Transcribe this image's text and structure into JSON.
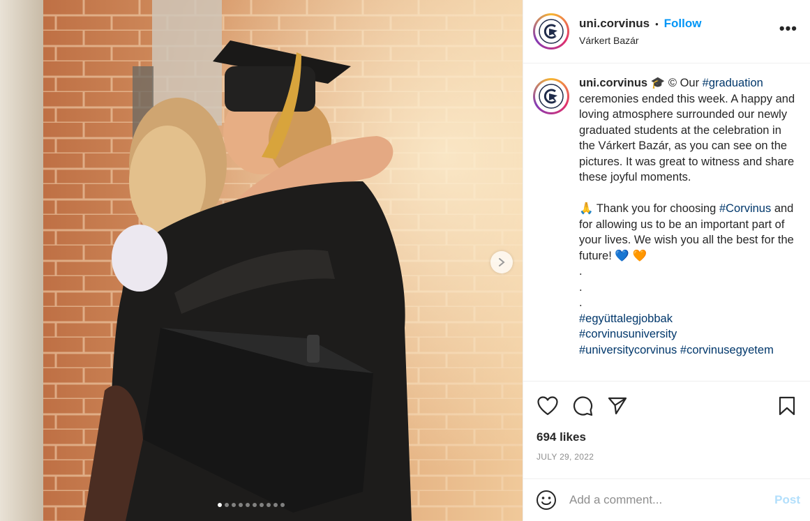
{
  "post": {
    "photo": {
      "alt_subject": "graduate-hug-photo",
      "carousel": {
        "total": 10,
        "active_index": 0
      }
    },
    "header": {
      "username": "uni.corvinus",
      "separator": "•",
      "follow_label": "Follow",
      "location": "Várkert Bazár",
      "more_label": "•••"
    },
    "caption": {
      "username": "uni.corvinus",
      "emoji_cap": "🎓",
      "p1_before": " © Our ",
      "tag_graduation": "#graduation",
      "p1_after": " ceremonies ended this week. A happy and loving atmosphere surrounded our newly graduated students at the celebration in the Várkert Bazár, as you can see on the pictures. It was great to witness and share these joyful moments.",
      "emoji_hands": "🙏",
      "p2_before": " Thank you for choosing ",
      "tag_corvinus": "#Corvinus",
      "p2_after": " and for allowing us to be an important part of your lives. We wish you all the best for the future! ",
      "emoji_hearts": "💙 🧡",
      "dot1": ".",
      "dot2": ".",
      "dot3": ".",
      "tag1": "#együttalegjobbak",
      "tag2": "#corvinusuniversity",
      "tag3": "#universitycorvinus",
      "tag4": "#corvinusegyetem"
    },
    "actions": {
      "like_icon": "heart-icon",
      "comment_icon": "comment-bubble-icon",
      "share_icon": "paper-plane-icon",
      "save_icon": "bookmark-icon",
      "likes_text": "694 likes",
      "date": "JULY 29, 2022"
    },
    "comment_box": {
      "emoji_icon": "smiley-icon",
      "placeholder": "Add a comment...",
      "post_label": "Post"
    },
    "colors": {
      "link_blue": "#0095f6",
      "hashtag": "#00376b",
      "post_disabled": "#b2dffc",
      "muted": "#8e8e8e"
    }
  }
}
